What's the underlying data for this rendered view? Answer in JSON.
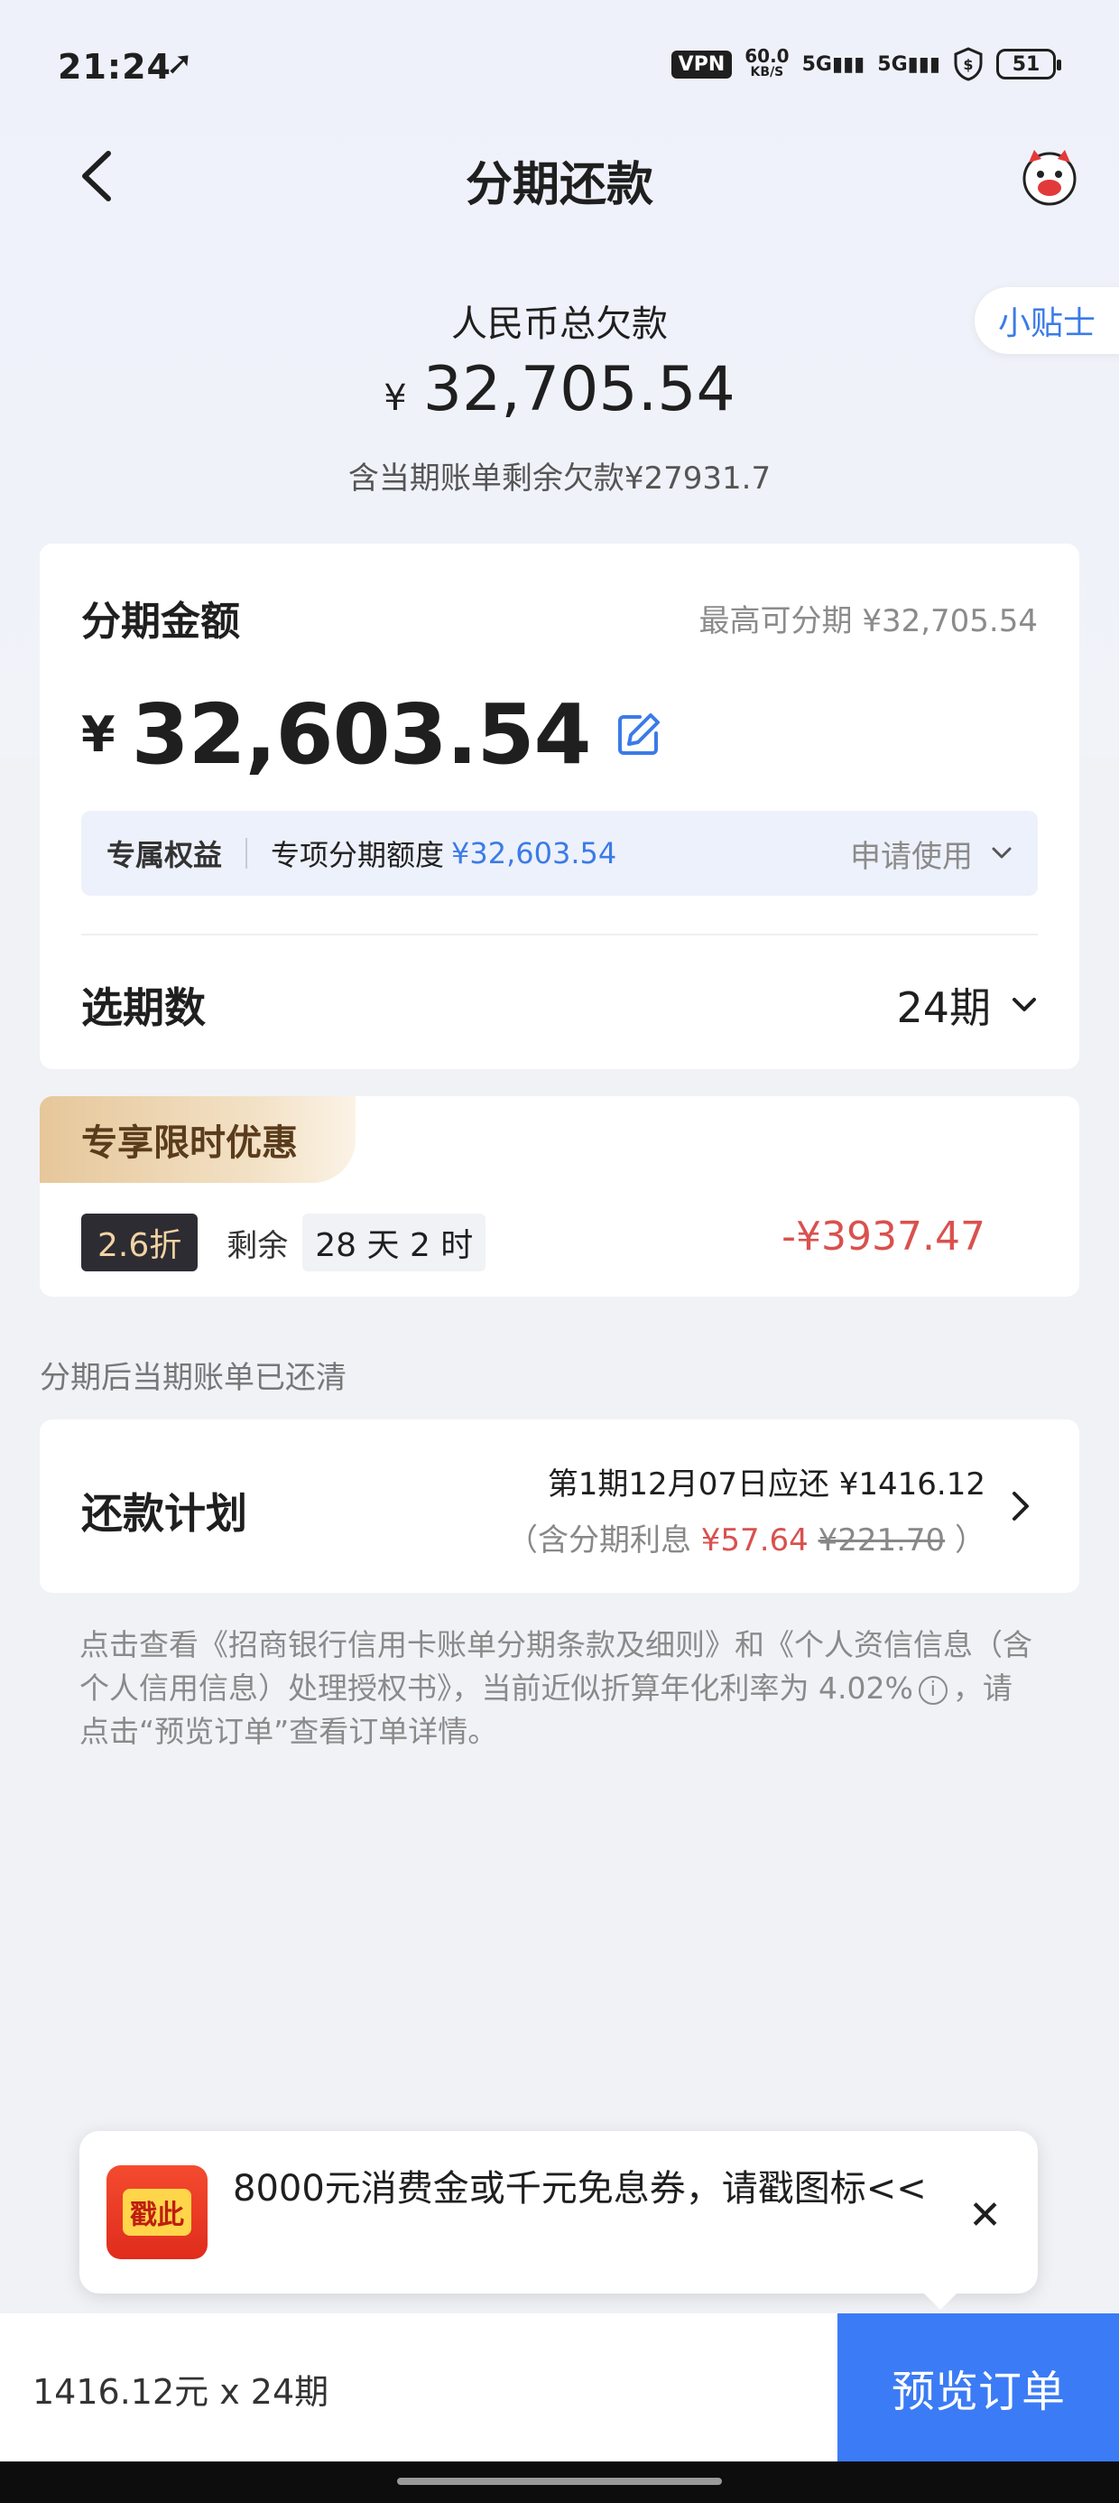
{
  "status_bar": {
    "time": "21:24",
    "location_icon": "location-arrow-icon",
    "vpn": "VPN",
    "net_speed_value": "60.0",
    "net_speed_unit": "KB/S",
    "signal1": "5G",
    "signal2": "5G",
    "battery": "51"
  },
  "nav": {
    "title": "分期还款",
    "back_icon": "chevron-left-icon",
    "mascot_icon": "mascot-icon"
  },
  "tips": {
    "label": "小贴士"
  },
  "summary": {
    "debt_label": "人民币总欠款",
    "currency": "¥",
    "debt_amount": "32,705.54",
    "sub_text": "含当期账单剩余欠款¥27931.7"
  },
  "installment": {
    "label": "分期金额",
    "max_text": "最高可分期 ¥32,705.54",
    "currency": "¥",
    "amount": "32,603.54",
    "benefit_tag": "专属权益",
    "benefit_desc": "专项分期额度",
    "benefit_value": "¥32,603.54",
    "benefit_apply": "申请使用",
    "period_label": "选期数",
    "period_value": "24期"
  },
  "promo": {
    "tag": "专享限时优惠",
    "discount": "2.6折",
    "remain_label": "剩余",
    "remain_time": "28 天 2 时",
    "saving": "-¥3937.47"
  },
  "cleared_note": "分期后当期账单已还清",
  "plan": {
    "label": "还款计划",
    "line1": "第1期12月07日应还 ¥1416.12",
    "line2_prefix": "（含分期利息 ",
    "interest": "¥57.64",
    "original_interest": "¥221.70",
    "line2_suffix": " ）"
  },
  "disclaimer": {
    "text": "点击查看《招商银行信用卡账单分期条款及细则》和《个人资信信息（含个人信用信息）处理授权书》，当前近似折算年化利率为 4.02%",
    "text_after": "，请点击“预览订单”查看订单详情。"
  },
  "coupon": {
    "seal": "戳此",
    "text": "8000元消费金或千元免息券，请戳图标<<",
    "close": "✕"
  },
  "bottom": {
    "summary": "1416.12元 x 24期",
    "preview_button": "预览订单"
  },
  "colors": {
    "accent": "#3b7bf5",
    "link": "#3b7be8",
    "red": "#d9514e",
    "gold": "#e6c79a"
  }
}
